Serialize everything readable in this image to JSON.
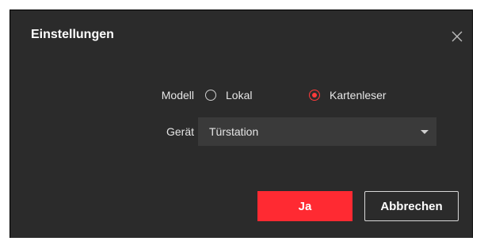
{
  "dialog": {
    "title": "Einstellungen",
    "close_icon": "close-icon"
  },
  "form": {
    "model": {
      "label": "Modell",
      "options": [
        {
          "label": "Lokal",
          "selected": false
        },
        {
          "label": "Kartenleser",
          "selected": true
        }
      ]
    },
    "device": {
      "label": "Gerät",
      "value": "Türstation",
      "dropdown_icon": "chevron-down-icon"
    }
  },
  "buttons": {
    "confirm_label": "Ja",
    "cancel_label": "Abbrechen"
  },
  "colors": {
    "dialog_background": "#2b2b2b",
    "accent": "#ff2a32",
    "text": "#e6e6e6"
  }
}
